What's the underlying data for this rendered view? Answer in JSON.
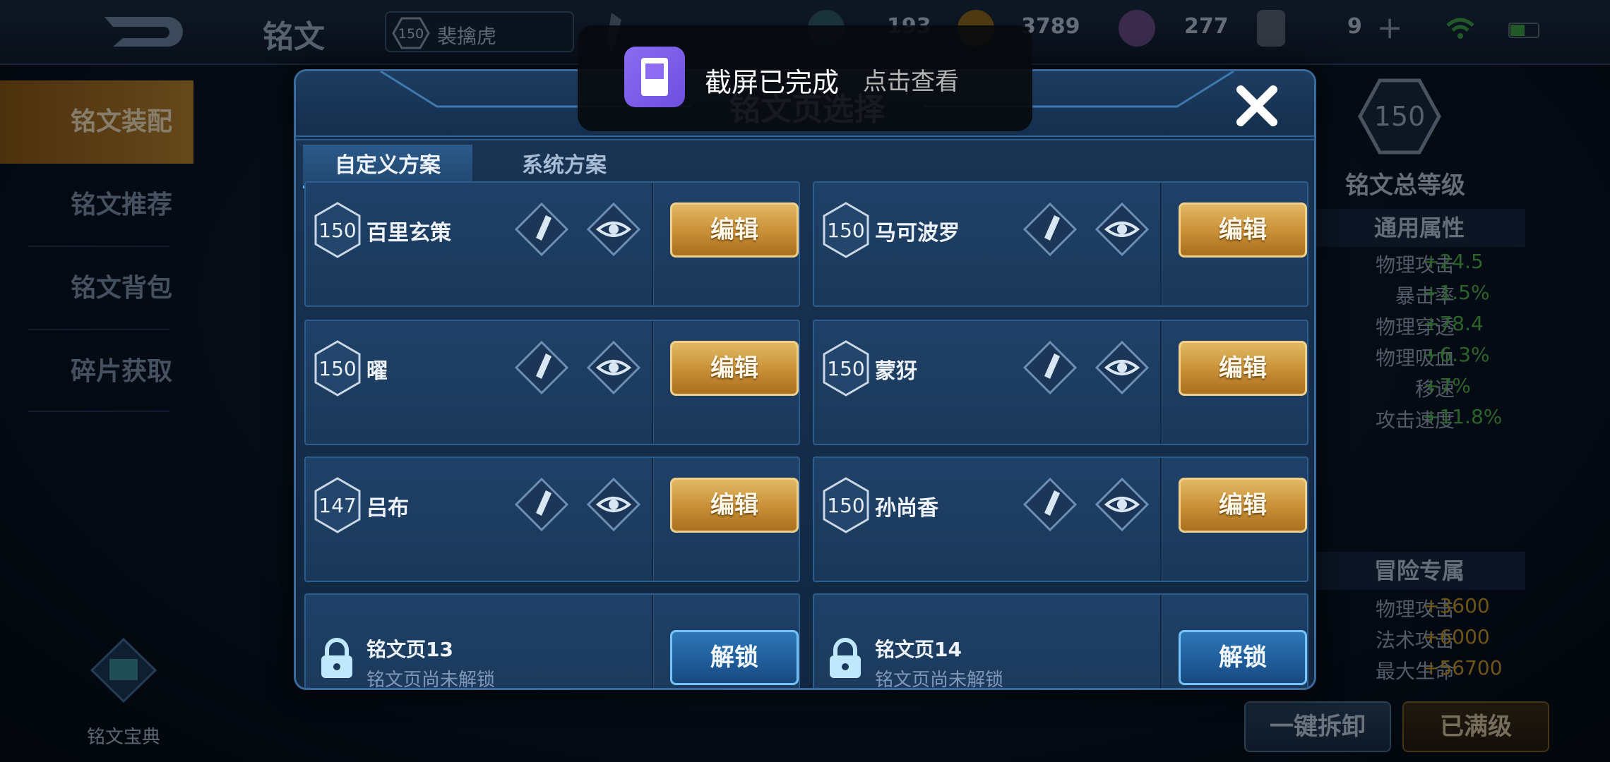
{
  "topbar": {
    "title": "铭文",
    "level": "150",
    "hero": "裴擒虎",
    "resources": [
      {
        "icon": "gem-icon",
        "value": "193"
      },
      {
        "icon": "gold-coin-icon",
        "value": "3789"
      },
      {
        "icon": "crystal-icon",
        "value": "277"
      },
      {
        "icon": "card-icon",
        "value": "9"
      }
    ]
  },
  "sidebar": {
    "items": [
      {
        "label": "铭文装配",
        "active": true
      },
      {
        "label": "铭文推荐",
        "active": false
      },
      {
        "label": "铭文背包",
        "active": false
      },
      {
        "label": "碎片获取",
        "active": false
      }
    ],
    "codex_label": "铭文宝典"
  },
  "right_panel": {
    "total_level": "150",
    "total_level_label": "铭文总等级",
    "general_title": "通用属性",
    "general_stats": [
      {
        "key": "物理攻击",
        "value": "+24.5"
      },
      {
        "key": "暴击率",
        "value": "+1.5%"
      },
      {
        "key": "物理穿透",
        "value": "+78.4"
      },
      {
        "key": "物理吸血",
        "value": "+6.3%"
      },
      {
        "key": "移速",
        "value": "+7%"
      },
      {
        "key": "攻击速度",
        "value": "+11.8%"
      }
    ],
    "adventure_title": "冒险专属",
    "adventure_stats": [
      {
        "key": "物理攻击",
        "value": "+3600"
      },
      {
        "key": "法术攻击",
        "value": "+6000"
      },
      {
        "key": "最大生命",
        "value": "+56700"
      }
    ],
    "dismantle_label": "一键拆卸",
    "maxed_label": "已满级"
  },
  "modal": {
    "title": "铭文页选择",
    "tabs": [
      {
        "label": "自定义方案",
        "active": true
      },
      {
        "label": "系统方案",
        "active": false
      }
    ],
    "edit_label": "编辑",
    "unlock_label": "解锁",
    "pages": [
      {
        "level": "150",
        "hero": "百里玄策"
      },
      {
        "level": "150",
        "hero": "马可波罗"
      },
      {
        "level": "150",
        "hero": "曜"
      },
      {
        "level": "150",
        "hero": "蒙犽"
      },
      {
        "level": "147",
        "hero": "吕布"
      },
      {
        "level": "150",
        "hero": "孙尚香"
      }
    ],
    "locked_pages": [
      {
        "name": "铭文页13",
        "status": "铭文页尚未解锁"
      },
      {
        "name": "铭文页14",
        "status": "铭文页尚未解锁"
      }
    ]
  },
  "toast": {
    "title": "截屏已完成",
    "action": "点击查看"
  },
  "colors": {
    "gold_button": "#c88e35",
    "blue_button": "#1f5b98",
    "stat_green": "#4fb64f",
    "stat_gold": "#c79a2e"
  }
}
